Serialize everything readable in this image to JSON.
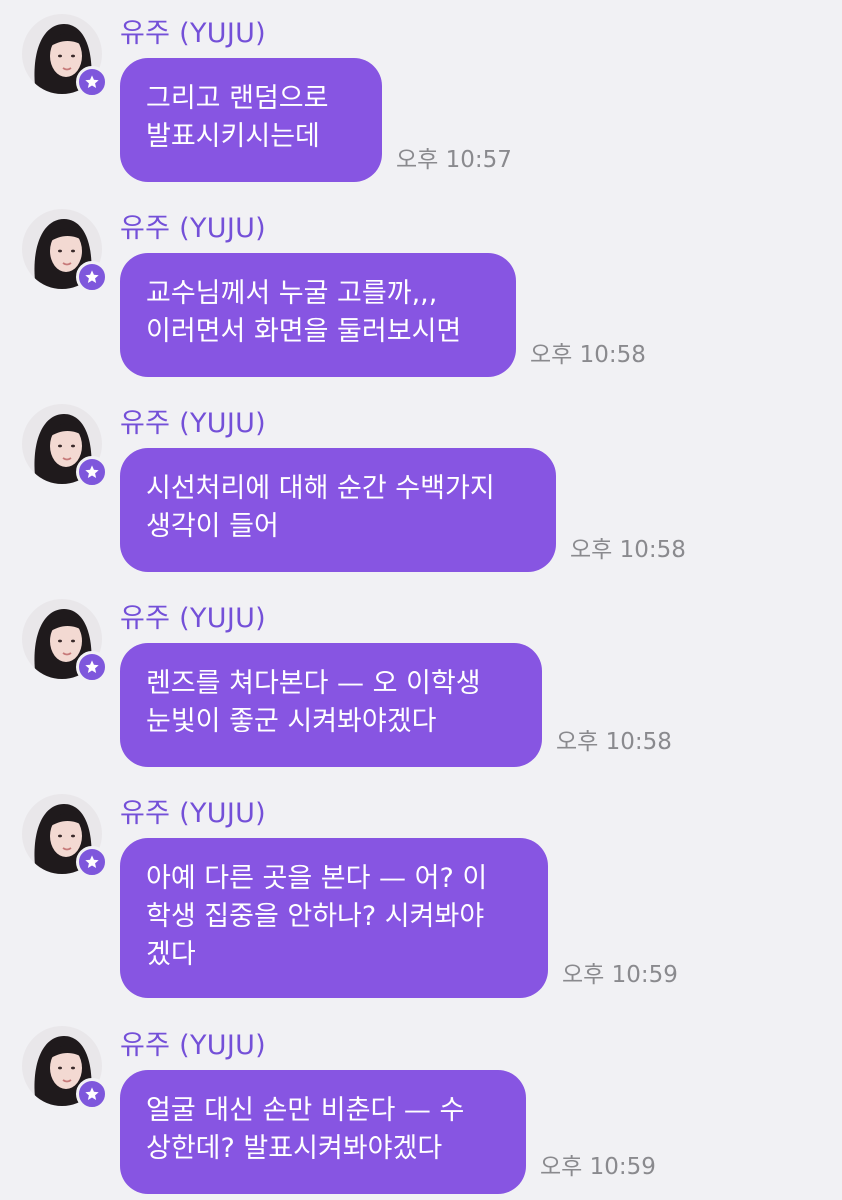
{
  "sender": {
    "name": "유주 (YUJU)",
    "avatar_icon": "profile-photo",
    "badge_icon": "star-icon",
    "accent_color": "#8755e2"
  },
  "messages": [
    {
      "lines": [
        "그리고 랜덤으로",
        "발표시키시는데"
      ],
      "time": "오후 10:57"
    },
    {
      "lines": [
        "교수님께서 누굴 고를까,,,",
        "이러면서 화면을 둘러보시면"
      ],
      "time": "오후 10:58"
    },
    {
      "lines": [
        "시선처리에 대해 순간 수백가지",
        "생각이 들어"
      ],
      "time": "오후 10:58"
    },
    {
      "lines": [
        "렌즈를 쳐다본다 — 오 이학생",
        "눈빛이 좋군 시켜봐야겠다"
      ],
      "time": "오후 10:58"
    },
    {
      "lines": [
        "아예 다른 곳을 본다 — 어? 이",
        "학생 집중을 안하나? 시켜봐야",
        "겠다"
      ],
      "time": "오후 10:59"
    },
    {
      "lines": [
        "얼굴 대신 손만 비춘다 — 수",
        "상한데? 발표시켜봐야겠다"
      ],
      "time": "오후 10:59"
    }
  ]
}
